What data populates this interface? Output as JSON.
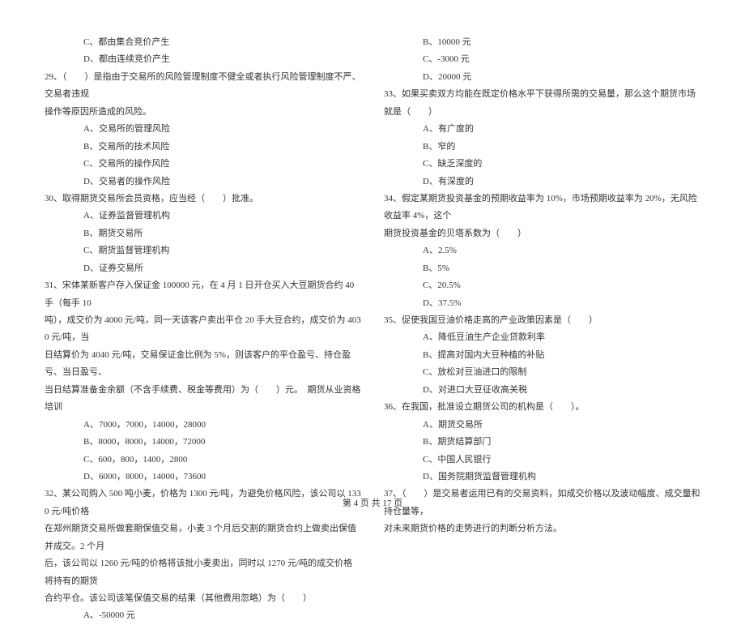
{
  "left": {
    "pre_opts": [
      "C、都由集合竞价产生",
      "D、都由连续竞价产生"
    ],
    "q29": {
      "stem1": "29、（　　）是指由于交易所的风险管理制度不健全或者执行风险管理制度不严、交易者违规",
      "stem2": "操作等原因所造成的风险。",
      "opts": [
        "A、交易所的管理风险",
        "B、交易所的技术风险",
        "C、交易所的操作风险",
        "D、交易者的操作风险"
      ]
    },
    "q30": {
      "stem": "30、取得期货交易所会员资格，应当经（　　）批准。",
      "opts": [
        "A、证券监督管理机构",
        "B、期货交易所",
        "C、期货监督管理机构",
        "D、证券交易所"
      ]
    },
    "q31": {
      "stem1": "31、宋体某新客户存入保证金 100000 元，在 4 月 1 日开仓买入大豆期货合约 40 手（每手 10",
      "stem2": "吨），成交价为 4000 元/吨，同一天该客户卖出平仓 20 手大豆合约，成交价为 4030 元/吨，当",
      "stem3": "日结算价为 4040 元/吨，交易保证金比例为 5%，则该客户的平仓盈亏、持仓盈亏、当日盈亏、",
      "stem4": "当日结算准备金余额（不含手续费、税金等费用）为（　　）元。　期货从业资格培训",
      "opts": [
        "A、7000，7000，14000，28000",
        "B、8000，8000，14000，72000",
        "C、600，800，1400，2800",
        "D、6000，8000，14000，73600"
      ]
    },
    "q32": {
      "stem1": "32、某公司购入 500 吨小麦，价格为 1300 元/吨，为避免价格风险，该公司以 1330 元/吨价格",
      "stem2": "在郑州期货交易所做套期保值交易，小麦 3 个月后交割的期货合约上做卖出保值并成交。2 个月",
      "stem3": "后，该公司以 1260 元/吨的价格将该批小麦卖出，同时以 1270 元/吨的成交价格将持有的期货",
      "stem4": "合约平仓。该公司该笔保值交易的结果（其他费用忽略）为（　　）",
      "opts": [
        "A、-50000 元"
      ]
    }
  },
  "right": {
    "pre_opts": [
      "B、10000 元",
      "C、-3000 元",
      "D、20000 元"
    ],
    "q33": {
      "stem": "33、如果买卖双方均能在既定价格水平下获得所需的交易量，那么这个期货市场就是（　　）",
      "opts": [
        "A、有广度的",
        "B、窄的",
        "C、缺乏深度的",
        "D、有深度的"
      ]
    },
    "q34": {
      "stem1": "34、假定某期货投资基金的预期收益率为 10%，市场预期收益率为 20%，无风险收益率 4%，这个",
      "stem2": "期货投资基金的贝塔系数为（　　）",
      "opts": [
        "A、2.5%",
        "B、5%",
        "C、20.5%",
        "D、37.5%"
      ]
    },
    "q35": {
      "stem": "35、促使我国豆油价格走高的产业政策因素是（　　）",
      "opts": [
        "A、降低豆油生产企业贷款利率",
        "B、提高对国内大豆种植的补贴",
        "C、放松对豆油进口的限制",
        "D、对进口大豆征收高关税"
      ]
    },
    "q36": {
      "stem": "36、在我国，批准设立期货公司的机构是（　　）。",
      "opts": [
        "A、期货交易所",
        "B、期货结算部门",
        "C、中国人民银行",
        "D、国务院期货监督管理机构"
      ]
    },
    "q37": {
      "stem1": "37、（　　）是交易者运用已有的交易资料，如成交价格以及波动幅度、成交量和持仓量等，",
      "stem2": "对未来期货价格的走势进行的判断分析方法。"
    }
  },
  "footer": "第 4 页 共 17 页"
}
